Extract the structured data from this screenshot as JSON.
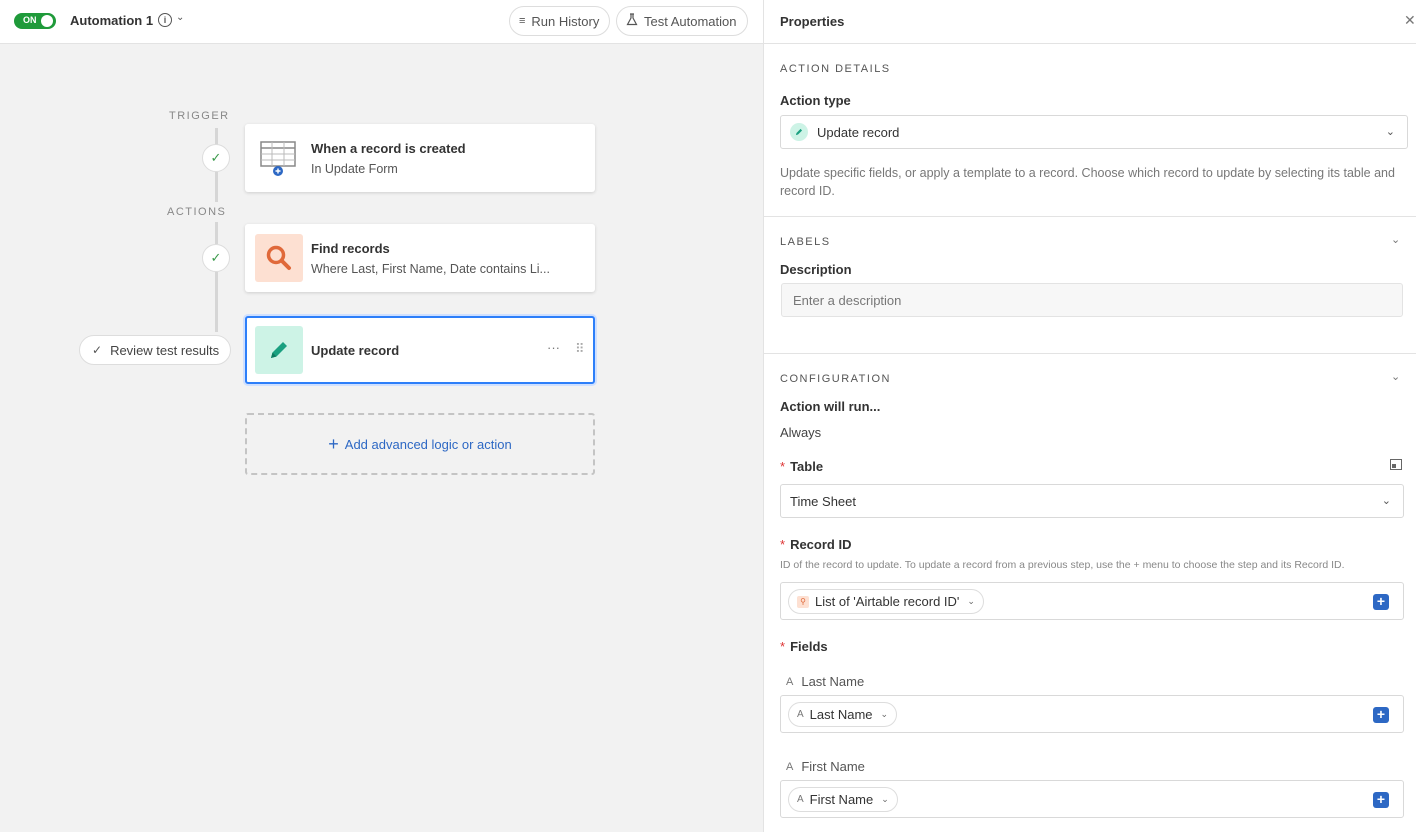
{
  "topbar": {
    "toggle_label": "ON",
    "automation_name": "Automation 1",
    "run_history_label": "Run History",
    "test_automation_label": "Test Automation"
  },
  "flow": {
    "trigger_label": "TRIGGER",
    "actions_label": "ACTIONS",
    "trigger_card": {
      "title": "When a record is created",
      "subtitle": "In Update Form"
    },
    "find_card": {
      "title": "Find records",
      "subtitle": "Where Last, First Name, Date contains Li..."
    },
    "update_card": {
      "title": "Update record",
      "menu": "···",
      "drag": "⠿"
    },
    "review_label": "Review test results",
    "add_label": "Add advanced logic or action"
  },
  "panel": {
    "title": "Properties",
    "action_details": {
      "caption": "ACTION DETAILS",
      "action_type_label": "Action type",
      "action_type_value": "Update record",
      "help": "Update specific fields, or apply a template to a record. Choose which record to update by selecting its table and record ID."
    },
    "labels": {
      "caption": "LABELS",
      "description_label": "Description",
      "description_placeholder": "Enter a description"
    },
    "configuration": {
      "caption": "CONFIGURATION",
      "action_runs_label": "Action will run...",
      "action_runs_value": "Always",
      "table_label": "Table",
      "table_value": "Time Sheet",
      "record_id_label": "Record ID",
      "record_id_help": "ID of the record to update. To update a record from a previous step, use the + menu to choose the step and its Record ID.",
      "record_id_token": "List of 'Airtable record ID'",
      "fields_label": "Fields",
      "fields": [
        {
          "label": "Last Name",
          "token": "Last Name"
        },
        {
          "label": "First Name",
          "token": "First Name"
        }
      ]
    }
  },
  "colors": {
    "toggle_on": "#1f9a3a",
    "accent_blue": "#2d68c4",
    "selected_border": "#2d7ff9",
    "find_icon_bg": "#fde0d2",
    "update_icon_bg": "#cdf3e6"
  }
}
